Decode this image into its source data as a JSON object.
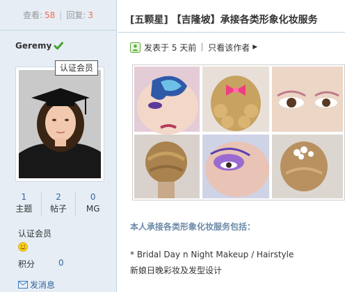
{
  "stats": {
    "views_label": "查看:",
    "views": "58",
    "replies_label": "回复:",
    "replies": "3"
  },
  "author": {
    "name": "Geremy",
    "tooltip": "认证会员",
    "counts": [
      {
        "value": "1",
        "label": "主题"
      },
      {
        "value": "2",
        "label": "帖子"
      },
      {
        "value": "0",
        "label": "MG"
      }
    ],
    "group": "认证会员",
    "points_label": "积分",
    "points": "0",
    "pm_label": "发消息"
  },
  "post": {
    "title": "[五颗星] 【吉隆坡】承接各类形象化妆服务",
    "posted": "发表于 5 天前",
    "author_only": "只看该作者",
    "heading": "本人承接各类形象化妆服务包括：",
    "line1": "* Bridal Day n Night Makeup / Hairstyle",
    "line2": "新娘日晚彩妆及发型设计"
  },
  "colors": {
    "accent": "#f26c4f",
    "link": "#336699",
    "sidebar_bg": "#e6edf5",
    "border": "#c2d5e3"
  }
}
